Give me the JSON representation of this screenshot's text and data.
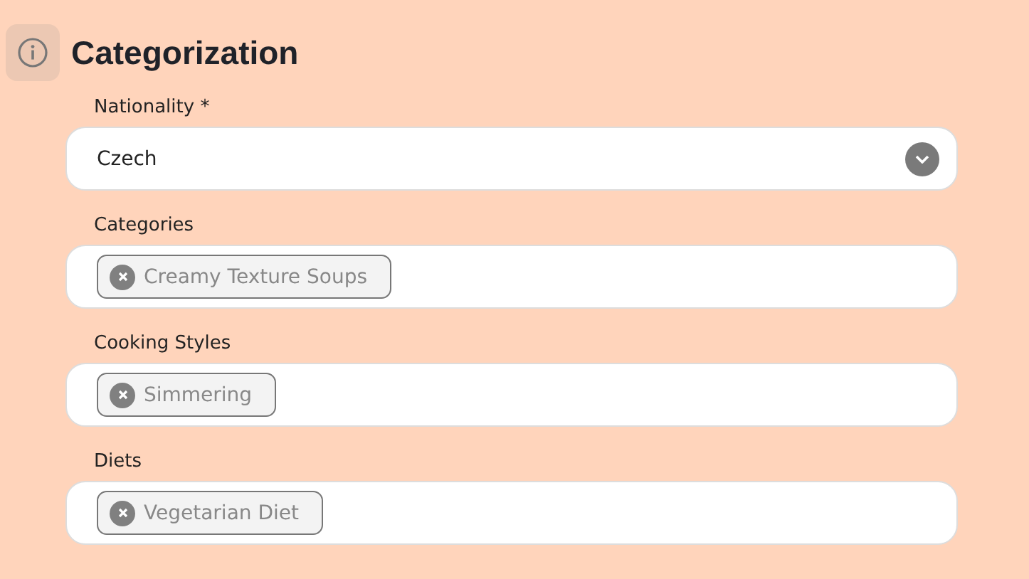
{
  "section": {
    "title": "Categorization"
  },
  "fields": [
    {
      "kind": "select",
      "label": "Nationality *",
      "value": "Czech"
    },
    {
      "kind": "tags",
      "label": "Categories",
      "tags": [
        "Creamy Texture Soups"
      ]
    },
    {
      "kind": "tags",
      "label": "Cooking Styles",
      "tags": [
        "Simmering"
      ]
    },
    {
      "kind": "tags",
      "label": "Diets",
      "tags": [
        "Vegetarian Diet"
      ]
    }
  ]
}
